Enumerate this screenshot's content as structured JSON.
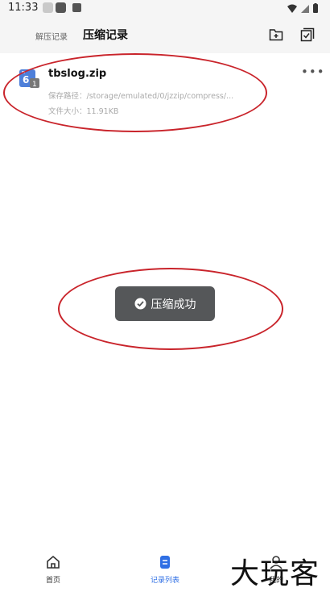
{
  "status_bar": {
    "time": "11:33"
  },
  "header": {
    "tab_unzip": "解压记录",
    "tab_compress": "压缩记录"
  },
  "record": {
    "file_name": "tbslog.zip",
    "badge": "1",
    "path": "保存路径：/storage/emulated/0/jzzip/compress/...",
    "size": "文件大小：11.91KB"
  },
  "toast": {
    "text": "压缩成功"
  },
  "bottom_nav": {
    "home": "首页",
    "records": "记录列表",
    "mine": "我的"
  },
  "watermark": {
    "text": "大玩客"
  },
  "colors": {
    "accent": "#2f6fe4",
    "annotation_red": "#c9242b",
    "toast_bg": "#555759"
  }
}
